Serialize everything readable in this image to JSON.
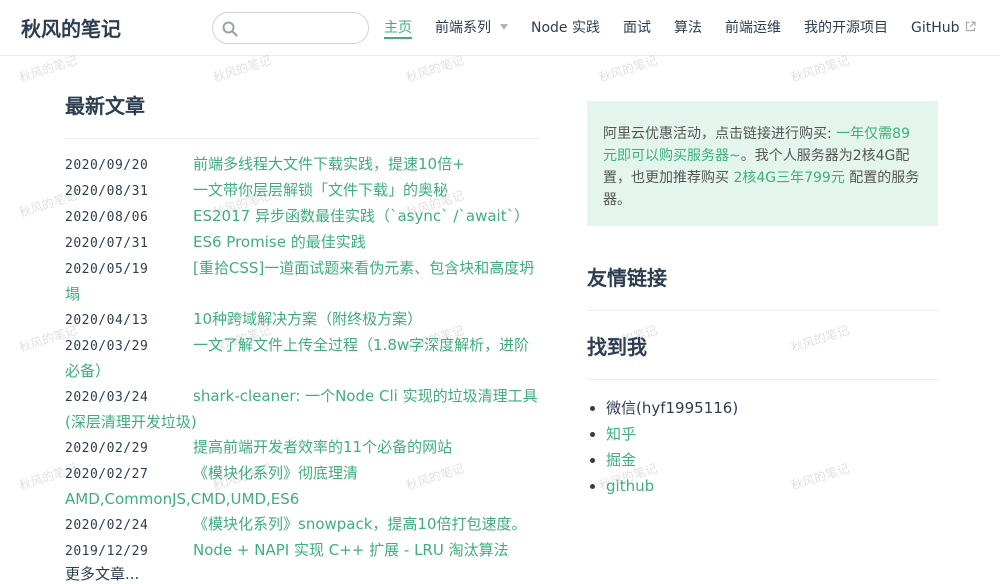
{
  "site": {
    "name": "秋风的笔记"
  },
  "search": {
    "placeholder": ""
  },
  "nav": {
    "items": [
      {
        "label": "主页",
        "active": true
      },
      {
        "label": "前端系列",
        "dropdown": true
      },
      {
        "label": "Node 实践"
      },
      {
        "label": "面试"
      },
      {
        "label": "算法"
      },
      {
        "label": "前端运维"
      },
      {
        "label": "我的开源项目"
      },
      {
        "label": "GitHub",
        "external": true
      }
    ]
  },
  "watermark": "秋风的笔记",
  "latest": {
    "title": "最新文章",
    "posts": [
      {
        "date": "2020/09/20",
        "title": "前端多线程大文件下载实践，提速10倍+"
      },
      {
        "date": "2020/08/31",
        "title": "一文带你层层解锁「文件下载」的奥秘"
      },
      {
        "date": "2020/08/06",
        "title": "ES2017 异步函数最佳实践（`async` /`await`）"
      },
      {
        "date": "2020/07/31",
        "title": "ES6 Promise 的最佳实践"
      },
      {
        "date": "2020/05/19",
        "title": "[重拾CSS]一道面试题来看伪元素、包含块和高度坍塌"
      },
      {
        "date": "2020/04/13",
        "title": "10种跨域解决方案（附终极方案）"
      },
      {
        "date": "2020/03/29",
        "title": "一文了解文件上传全过程（1.8w字深度解析，进阶必备）"
      },
      {
        "date": "2020/03/24",
        "title": "shark-cleaner: 一个Node Cli 实现的垃圾清理工具(深层清理开发垃圾)"
      },
      {
        "date": "2020/02/29",
        "title": "提高前端开发者效率的11个必备的网站"
      },
      {
        "date": "2020/02/27",
        "title": "《模块化系列》彻底理清 AMD,CommonJS,CMD,UMD,ES6"
      },
      {
        "date": "2020/02/24",
        "title": "《模块化系列》snowpack，提高10倍打包速度。"
      },
      {
        "date": "2019/12/29",
        "title": "Node + NAPI 实现 C++ 扩展 - LRU 淘汰算法"
      }
    ],
    "more": "更多文章..."
  },
  "promo": {
    "text1": "阿里云优惠活动，点击链接进行购买: ",
    "link1": "一年仅需89元即可以购买服务器~",
    "text2": "。我个人服务器为2核4G配置，也更加推荐购买 ",
    "link2": "2核4G三年799元",
    "text3": " 配置的服务器。"
  },
  "friends": {
    "title": "友情链接"
  },
  "findme": {
    "title": "找到我",
    "items": [
      {
        "label": "微信(hyf1995116)",
        "link": false
      },
      {
        "label": "知乎",
        "link": true
      },
      {
        "label": "掘金",
        "link": true
      },
      {
        "label": "github",
        "link": true
      }
    ]
  },
  "colors": {
    "accent": "#3eaf7c",
    "text": "#2c3e50",
    "promo_bg": "#e3f5ec"
  }
}
